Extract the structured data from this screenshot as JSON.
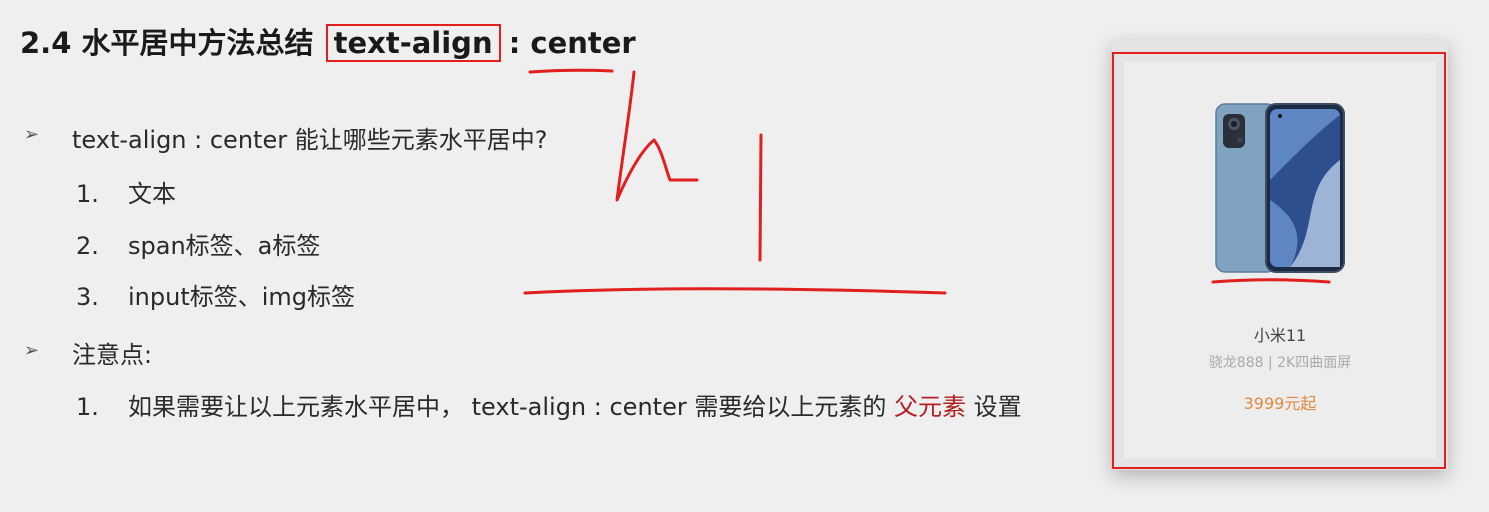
{
  "title": {
    "prefix": "2.4 水平居中方法总结",
    "boxed": "text-align",
    "suffix": " : center"
  },
  "bullets": [
    {
      "text": "text-align : center 能让哪些元素水平居中?",
      "items": [
        {
          "num": "1.",
          "text": "文本"
        },
        {
          "num": "2.",
          "text": "span标签、a标签"
        },
        {
          "num": "3.",
          "text": "input标签、img标签"
        }
      ]
    },
    {
      "text": "注意点:",
      "items": [
        {
          "num": "1.",
          "text_before": "如果需要让以上元素水平居中， text-align : center 需要给以上元素的 ",
          "highlight": "父元素",
          "text_after": " 设置"
        }
      ]
    }
  ],
  "product": {
    "image_icon": "smartphone-image",
    "name": "小米11",
    "desc": "骁龙888 | 2K四曲面屏",
    "price": "3999元起"
  },
  "colors": {
    "annotation": "#e21f1f",
    "price": "#e08a3c",
    "highlight": "#b02020"
  }
}
